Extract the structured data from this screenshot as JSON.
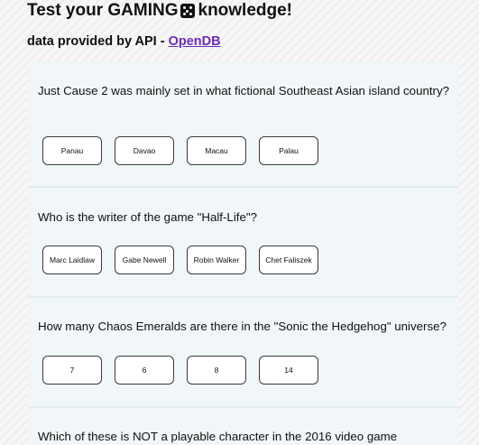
{
  "header": {
    "title_prefix": "Test your GAMING",
    "title_suffix": "knowledge!",
    "subtitle_prefix": "data provided by API - ",
    "subtitle_link": "OpenDB"
  },
  "questions": [
    {
      "text": "Just Cause 2 was mainly set in what fictional Southeast Asian island country?",
      "answers": [
        "Panau",
        "Davao",
        "Macau",
        "Palau"
      ]
    },
    {
      "text": "Who is the writer of the game \"Half-Life\"?",
      "answers": [
        "Marc Laidlaw",
        "Gabe Newell",
        "Robin Walker",
        "Chet Faliszek"
      ]
    },
    {
      "text": "How many Chaos Emeralds are there in the \"Sonic the Hedgehog\" universe?",
      "answers": [
        "7",
        "6",
        "8",
        "14"
      ]
    },
    {
      "text": "Which of these is NOT a playable character in the 2016 video game"
    }
  ]
}
